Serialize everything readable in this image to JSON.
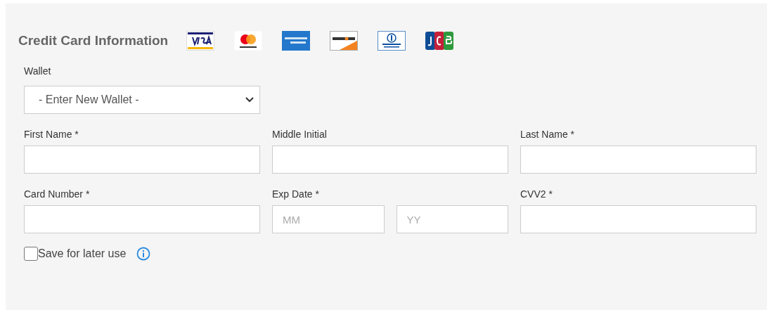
{
  "title": "Credit Card Information",
  "card_logos": [
    {
      "kind": "visa"
    },
    {
      "kind": "mastercard"
    },
    {
      "kind": "amex"
    },
    {
      "kind": "discover"
    },
    {
      "kind": "diners"
    },
    {
      "kind": "jcb"
    }
  ],
  "wallet": {
    "label": "Wallet",
    "value": "- Enter New Wallet -"
  },
  "rows": [
    [
      {
        "kind": "text",
        "label": "First Name *"
      },
      {
        "kind": "text",
        "label": "Middle Initial"
      },
      {
        "kind": "text",
        "label": "Last Name *"
      }
    ],
    [
      {
        "kind": "text",
        "label": "Card Number *"
      },
      {
        "kind": "pair",
        "label": "Exp Date *",
        "placeholders": [
          "MM",
          "YY"
        ]
      },
      {
        "kind": "text",
        "label": "CVV2 *"
      }
    ]
  ],
  "save": {
    "label": "Save for later use",
    "checked": false
  }
}
